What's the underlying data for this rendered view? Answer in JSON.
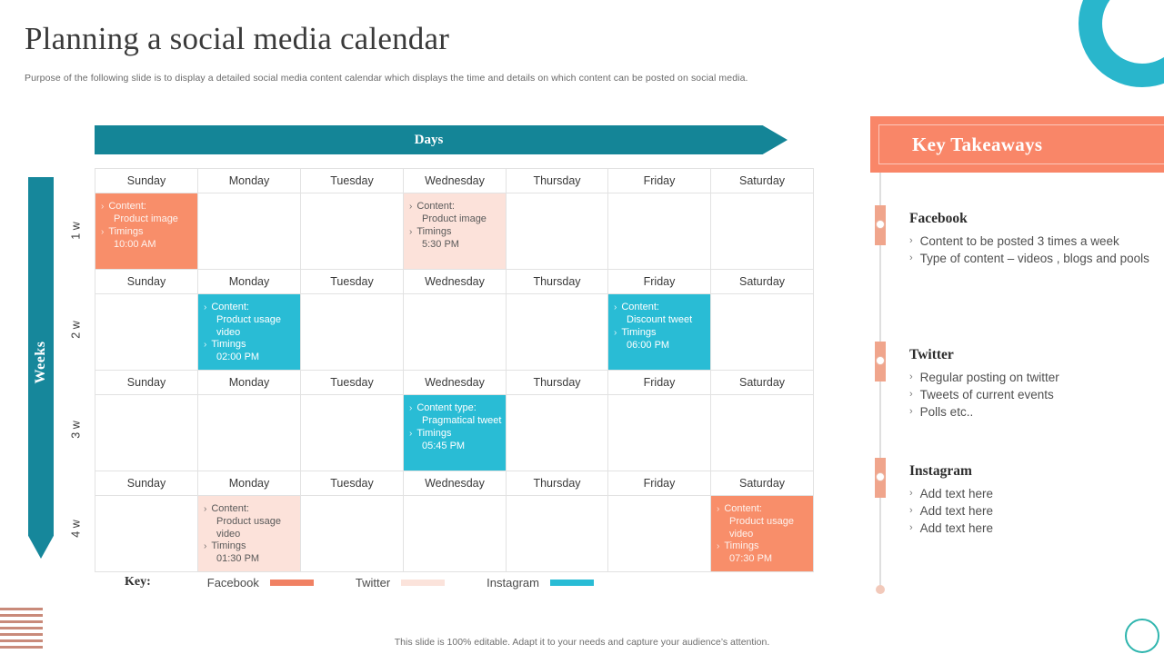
{
  "header": {
    "title": "Planning a social media calendar",
    "subtitle": "Purpose of the following slide is to display a detailed social media content calendar which displays the time and details on which content can be posted on social media."
  },
  "calendar": {
    "days_banner_label": "Days",
    "weeks_axis_label": "Weeks",
    "day_names": [
      "Sunday",
      "Monday",
      "Tuesday",
      "Wednesday",
      "Thursday",
      "Friday",
      "Saturday"
    ],
    "week_ticks": [
      "1 w",
      "2 w",
      "3 w",
      "4 w"
    ],
    "weeks": [
      {
        "tick": "1 w",
        "events": [
          {
            "day": "Sunday",
            "platform": "facebook",
            "line1_label": "Content:",
            "line1_value": "Product image",
            "line2_label": "Timings",
            "line2_value": "10:00 AM"
          },
          {
            "day": "Wednesday",
            "platform": "twitter",
            "line1_label": "Content:",
            "line1_value": "Product image",
            "line2_label": "Timings",
            "line2_value": "5:30 PM"
          }
        ]
      },
      {
        "tick": "2 w",
        "events": [
          {
            "day": "Monday",
            "platform": "instagram",
            "line1_label": "Content:",
            "line1_value": "Product usage video",
            "line2_label": "Timings",
            "line2_value": "02:00 PM"
          },
          {
            "day": "Friday",
            "platform": "instagram",
            "line1_label": "Content:",
            "line1_value": "Discount tweet",
            "line2_label": "Timings",
            "line2_value": "06:00 PM"
          }
        ]
      },
      {
        "tick": "3 w",
        "events": [
          {
            "day": "Wednesday",
            "platform": "instagram",
            "line1_label": "Content type:",
            "line1_value": "Pragmatical tweet",
            "line2_label": "Timings",
            "line2_value": "05:45 PM"
          }
        ]
      },
      {
        "tick": "4 w",
        "events": [
          {
            "day": "Monday",
            "platform": "twitter",
            "line1_label": "Content:",
            "line1_value": "Product usage video",
            "line2_label": "Timings",
            "line2_value": "01:30 PM"
          },
          {
            "day": "Saturday",
            "platform": "facebook",
            "line1_label": "Content:",
            "line1_value": "Product usage video",
            "line2_label": "Timings",
            "line2_value": "07:30 PM"
          }
        ]
      }
    ]
  },
  "key": {
    "label": "Key:",
    "items": [
      {
        "name": "Facebook",
        "color": "#F08163"
      },
      {
        "name": "Twitter",
        "color": "#FBE3DB"
      },
      {
        "name": "Instagram",
        "color": "#29BCD5"
      }
    ]
  },
  "takeaways": {
    "title": "Key Takeaways",
    "groups": [
      {
        "heading": "Facebook",
        "bullets": [
          "Content to be posted 3 times a week",
          "Type of content – videos , blogs and pools"
        ]
      },
      {
        "heading": "Twitter",
        "bullets": [
          "Regular posting on twitter",
          "Tweets of current events",
          "Polls etc.."
        ]
      },
      {
        "heading": "Instagram",
        "bullets": [
          "Add text here",
          "Add text here",
          "Add text here"
        ]
      }
    ]
  },
  "footer": {
    "note": "This slide is 100% editable. Adapt it to your needs and capture your audience’s attention."
  },
  "colors": {
    "teal_banner": "#148597",
    "teal_weeks": "#16879B",
    "facebook": "#F88E6A",
    "twitter": "#FCE2DA",
    "instagram": "#29BCD5",
    "takeaway_band": "#F98668",
    "decor_ring": "#29B6CC"
  },
  "icons": {
    "bullet_chevron": "›"
  }
}
